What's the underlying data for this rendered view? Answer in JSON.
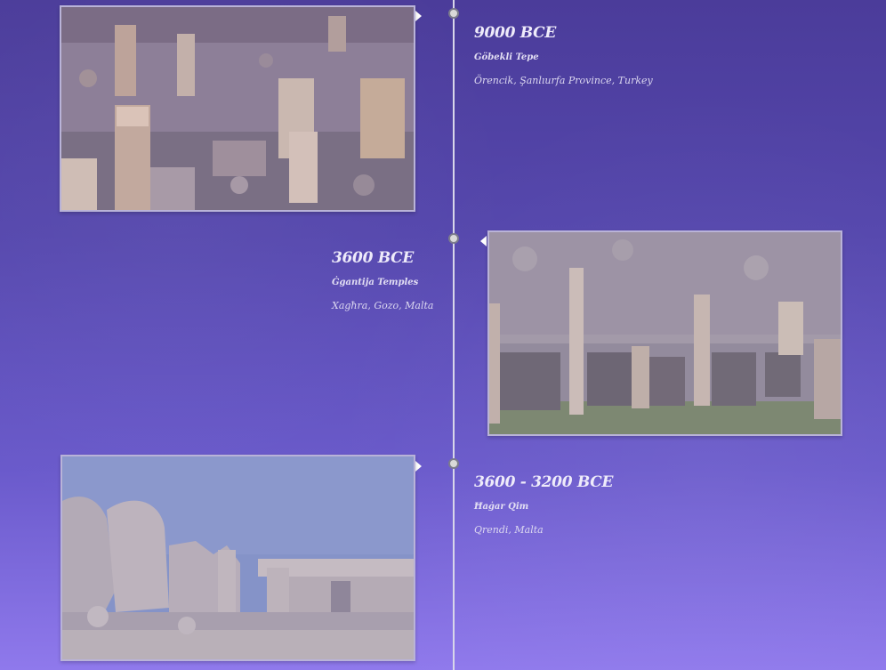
{
  "entries": [
    {
      "year": "9000 BCE",
      "site": "Göbekli Tepe",
      "location": "Örencik, Şanlıurfa Province, Turkey",
      "photo_icon": "excavation-photo"
    },
    {
      "year": "3600 BCE",
      "site": "Ġgantija Temples",
      "location": "Xagħra, Gozo, Malta",
      "photo_icon": "temple-photo"
    },
    {
      "year": "3600 - 3200 BCE",
      "site": "Ħaġar Qim",
      "location": "Qrendi, Malta",
      "photo_icon": "megalith-photo"
    }
  ],
  "colors": {
    "bg_top": "#4b3c9a",
    "bg_bottom": "#8f79ec",
    "line": "#d8d6ea",
    "dot": "#d9d9d9"
  }
}
